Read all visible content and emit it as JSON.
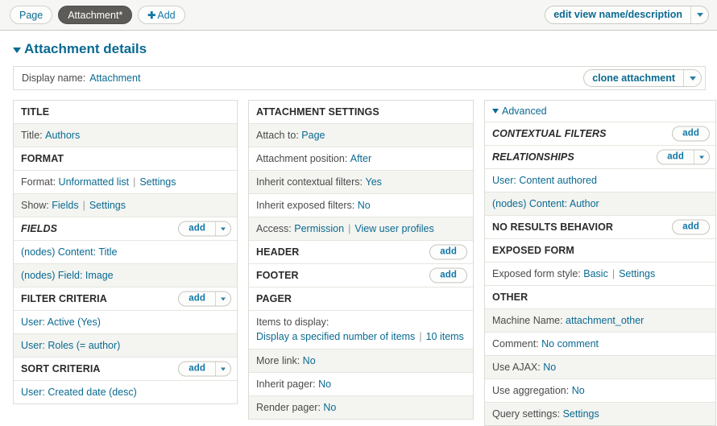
{
  "tabbar": {
    "tabs": [
      {
        "label": "Page",
        "active": false,
        "icon": null
      },
      {
        "label": "Attachment*",
        "active": true,
        "icon": null
      },
      {
        "label": "Add",
        "active": false,
        "icon": "plus-icon"
      }
    ],
    "edit_view_button": {
      "label": "edit view name/description",
      "icon": "chevron-down-icon"
    }
  },
  "details": {
    "title": "Attachment details",
    "toggle_icon": "triangle-down-icon",
    "display_name_label": "Display name:",
    "display_name_value": "Attachment",
    "clone_button": {
      "label": "clone attachment",
      "icon": "chevron-down-icon"
    }
  },
  "col1": {
    "rows": [
      {
        "type": "header",
        "label": "TITLE",
        "italic": false,
        "alt": false,
        "button": null
      },
      {
        "type": "kv",
        "key": "Title:",
        "values": [
          "Authors"
        ],
        "alt": true
      },
      {
        "type": "header",
        "label": "FORMAT",
        "italic": false,
        "alt": false,
        "button": null
      },
      {
        "type": "kv",
        "key": "Format:",
        "values": [
          "Unformatted list",
          "Settings"
        ],
        "alt": false
      },
      {
        "type": "kv",
        "key": "Show:",
        "values": [
          "Fields",
          "Settings"
        ],
        "alt": true
      },
      {
        "type": "header",
        "label": "FIELDS",
        "italic": true,
        "alt": false,
        "button": {
          "label": "add",
          "dropdown": true
        }
      },
      {
        "type": "link",
        "values": [
          "(nodes) Content: Title"
        ],
        "alt": false
      },
      {
        "type": "link",
        "values": [
          "(nodes) Field: Image"
        ],
        "alt": true
      },
      {
        "type": "header",
        "label": "FILTER CRITERIA",
        "italic": false,
        "alt": false,
        "button": {
          "label": "add",
          "dropdown": true
        }
      },
      {
        "type": "link",
        "values": [
          "User: Active (Yes)"
        ],
        "alt": false
      },
      {
        "type": "link",
        "values": [
          "User: Roles (= author)"
        ],
        "alt": true
      },
      {
        "type": "header",
        "label": "SORT CRITERIA",
        "italic": false,
        "alt": false,
        "button": {
          "label": "add",
          "dropdown": true
        }
      },
      {
        "type": "link",
        "values": [
          "User: Created date (desc)"
        ],
        "alt": false
      }
    ]
  },
  "col2": {
    "rows": [
      {
        "type": "header",
        "label": "ATTACHMENT SETTINGS",
        "italic": false,
        "alt": false,
        "button": null
      },
      {
        "type": "kv",
        "key": "Attach to:",
        "values": [
          "Page"
        ],
        "alt": true
      },
      {
        "type": "kv",
        "key": "Attachment position:",
        "values": [
          "After"
        ],
        "alt": false
      },
      {
        "type": "kv",
        "key": "Inherit contextual filters:",
        "values": [
          "Yes"
        ],
        "alt": true
      },
      {
        "type": "kv",
        "key": "Inherit exposed filters:",
        "values": [
          "No"
        ],
        "alt": false
      },
      {
        "type": "kv",
        "key": "Access:",
        "values": [
          "Permission",
          "View user profiles"
        ],
        "alt": true
      },
      {
        "type": "header",
        "label": "HEADER",
        "italic": false,
        "alt": false,
        "button": {
          "label": "add",
          "dropdown": false
        }
      },
      {
        "type": "header",
        "label": "FOOTER",
        "italic": false,
        "alt": false,
        "button": {
          "label": "add",
          "dropdown": false
        }
      },
      {
        "type": "header",
        "label": "PAGER",
        "italic": false,
        "alt": false,
        "button": null
      },
      {
        "type": "twoline",
        "key": "Items to display:",
        "values": [
          "Display a specified number of items",
          "10 items"
        ],
        "alt": false
      },
      {
        "type": "kv",
        "key": "More link:",
        "values": [
          "No"
        ],
        "alt": true
      },
      {
        "type": "kv",
        "key": "Inherit pager:",
        "values": [
          "No"
        ],
        "alt": false
      },
      {
        "type": "kv",
        "key": "Render pager:",
        "values": [
          "No"
        ],
        "alt": true
      }
    ]
  },
  "col3": {
    "advanced_label": "Advanced",
    "advanced_icon": "triangle-down-icon",
    "rows": [
      {
        "type": "header",
        "label": "CONTEXTUAL FILTERS",
        "italic": true,
        "alt": false,
        "button": {
          "label": "add",
          "dropdown": false
        }
      },
      {
        "type": "header",
        "label": "RELATIONSHIPS",
        "italic": true,
        "alt": false,
        "button": {
          "label": "add",
          "dropdown": true
        }
      },
      {
        "type": "link",
        "values": [
          "User: Content authored"
        ],
        "alt": false
      },
      {
        "type": "link",
        "values": [
          "(nodes) Content: Author"
        ],
        "alt": true
      },
      {
        "type": "header",
        "label": "NO RESULTS BEHAVIOR",
        "italic": false,
        "alt": false,
        "button": {
          "label": "add",
          "dropdown": false
        }
      },
      {
        "type": "header",
        "label": "EXPOSED FORM",
        "italic": false,
        "alt": false,
        "button": null
      },
      {
        "type": "kv",
        "key": "Exposed form style:",
        "values": [
          "Basic",
          "Settings"
        ],
        "alt": false
      },
      {
        "type": "header",
        "label": "OTHER",
        "italic": false,
        "alt": false,
        "button": null
      },
      {
        "type": "kv",
        "key": "Machine Name:",
        "values": [
          "attachment_other"
        ],
        "alt": true
      },
      {
        "type": "kv",
        "key": "Comment:",
        "values": [
          "No comment"
        ],
        "alt": false
      },
      {
        "type": "kv",
        "key": "Use AJAX:",
        "values": [
          "No"
        ],
        "alt": true
      },
      {
        "type": "kv",
        "key": "Use aggregation:",
        "values": [
          "No"
        ],
        "alt": false
      },
      {
        "type": "kv",
        "key": "Query settings:",
        "values": [
          "Settings"
        ],
        "alt": true
      }
    ]
  },
  "colors": {
    "link": "#0a6a91",
    "active_tab_bg": "#5d5b57",
    "row_alt_bg": "#f4f4f1",
    "border": "#dcdcd6"
  }
}
